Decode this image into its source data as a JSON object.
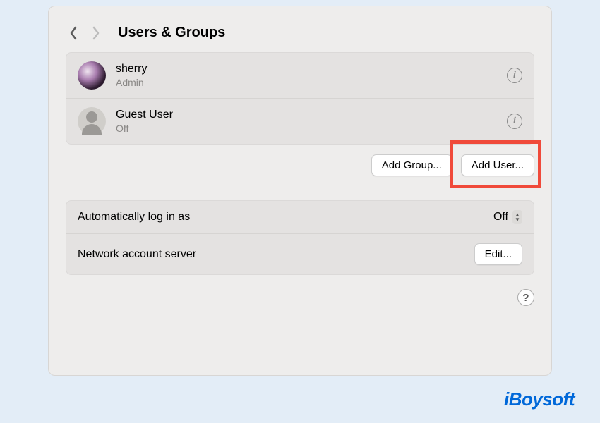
{
  "header": {
    "title": "Users & Groups"
  },
  "users": [
    {
      "name": "sherry",
      "role": "Admin"
    },
    {
      "name": "Guest User",
      "role": "Off"
    }
  ],
  "buttons": {
    "add_group": "Add Group...",
    "add_user": "Add User..."
  },
  "settings": {
    "auto_login_label": "Automatically log in as",
    "auto_login_value": "Off",
    "network_server_label": "Network account server",
    "network_server_button": "Edit..."
  },
  "help_label": "?",
  "watermark": "iBoysoft",
  "info_glyph": "i"
}
